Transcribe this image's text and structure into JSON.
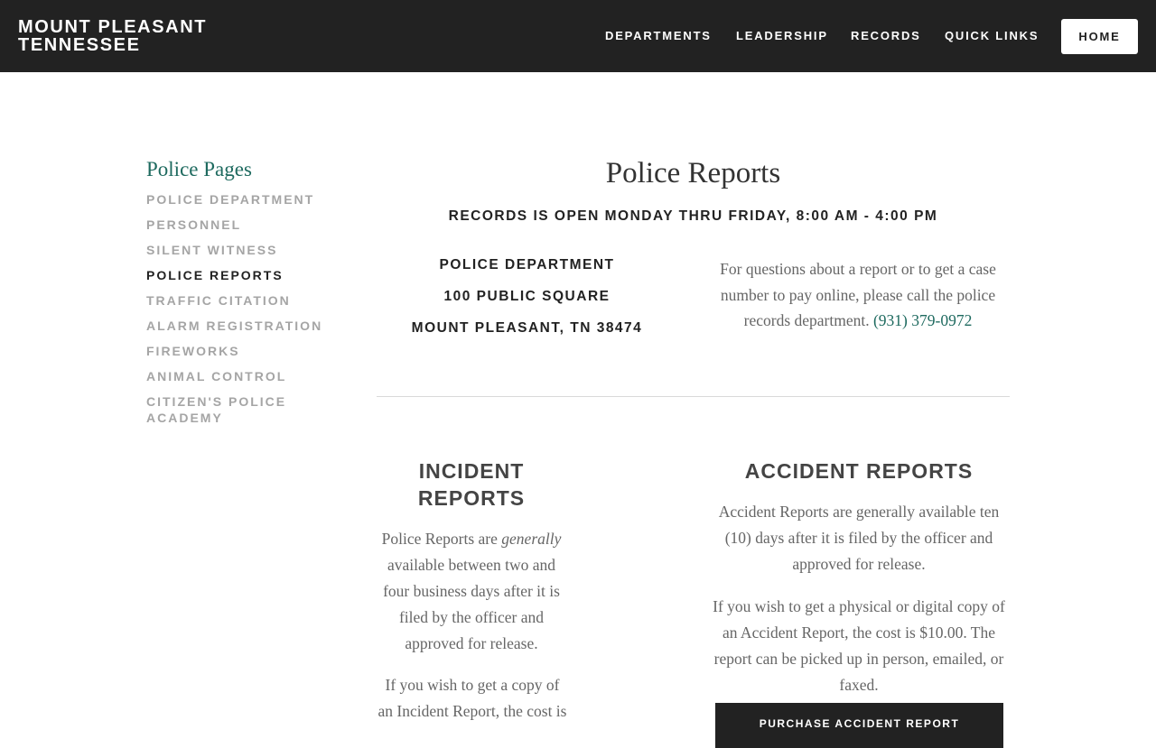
{
  "header": {
    "brand_line1": "MOUNT PLEASANT",
    "brand_line2": "TENNESSEE",
    "nav": [
      "DEPARTMENTS",
      "LEADERSHIP",
      "RECORDS",
      "QUICK LINKS"
    ],
    "home_label": "HOME"
  },
  "sidebar": {
    "title": "Police Pages",
    "items": [
      {
        "label": "POLICE DEPARTMENT"
      },
      {
        "label": "PERSONNEL"
      },
      {
        "label": "SILENT WITNESS"
      },
      {
        "label": "POLICE REPORTS"
      },
      {
        "label": "TRAFFIC CITATION"
      },
      {
        "label": "ALARM REGISTRATION"
      },
      {
        "label": "FIREWORKS"
      },
      {
        "label": "ANIMAL CONTROL"
      },
      {
        "label": "CITIZEN'S POLICE ACADEMY"
      }
    ],
    "active": "POLICE REPORTS"
  },
  "main": {
    "title": "Police Reports",
    "hours": "RECORDS IS OPEN MONDAY THRU FRIDAY, 8:00 AM - 4:00 PM",
    "address": [
      "POLICE DEPARTMENT",
      "100 PUBLIC SQUARE",
      "MOUNT PLEASANT, TN 38474"
    ],
    "contact_text": "For questions about a report or to get a case number to pay online, please call the police records department.",
    "contact_phone": "(931) 379-0972",
    "incident": {
      "heading_line1": "INCIDENT",
      "heading_line2": "REPORTS",
      "p1_before": "Police Reports are",
      "p1_em": "generally",
      "p1_after": "available between two and four business days after it is filed by the officer and approved for release.",
      "p2": "If you wish to get a copy of an Incident Report, the cost is"
    },
    "accident": {
      "heading": "ACCIDENT REPORTS",
      "p1": "Accident Reports are generally available ten (10) days after it is filed by the officer and approved for release.",
      "p2": "If you wish to get a physical or digital copy of an Accident Report, the cost is $10.00. The report can be picked up in person, emailed, or faxed.",
      "button_label": "PURCHASE ACCIDENT REPORT"
    }
  }
}
